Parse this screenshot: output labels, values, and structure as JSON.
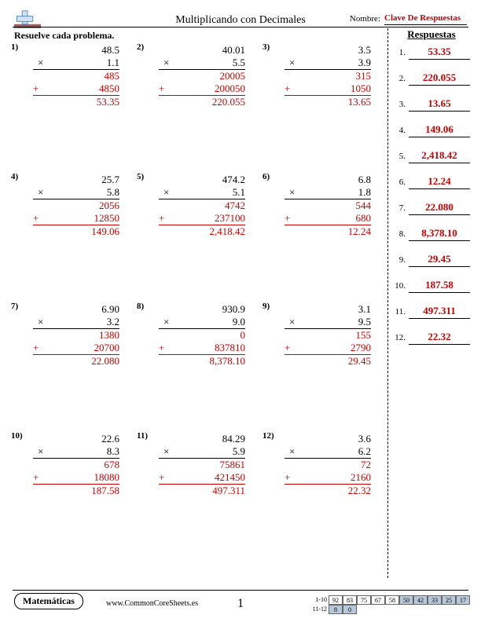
{
  "header": {
    "title": "Multiplicando con Decimales",
    "name_label": "Nombre:",
    "name_value": "Clave De Respuestas"
  },
  "solve_label": "Resuelve cada problema.",
  "problems": [
    {
      "n": "1)",
      "top": "48.5",
      "bot": "1.1",
      "p1": "485",
      "p2": "4850",
      "res": "53.35"
    },
    {
      "n": "2)",
      "top": "40.01",
      "bot": "5.5",
      "p1": "20005",
      "p2": "200050",
      "res": "220.055"
    },
    {
      "n": "3)",
      "top": "3.5",
      "bot": "3.9",
      "p1": "315",
      "p2": "1050",
      "res": "13.65"
    },
    {
      "n": "4)",
      "top": "25.7",
      "bot": "5.8",
      "p1": "2056",
      "p2": "12850",
      "res": "149.06"
    },
    {
      "n": "5)",
      "top": "474.2",
      "bot": "5.1",
      "p1": "4742",
      "p2": "237100",
      "res": "2,418.42"
    },
    {
      "n": "6)",
      "top": "6.8",
      "bot": "1.8",
      "p1": "544",
      "p2": "680",
      "res": "12.24"
    },
    {
      "n": "7)",
      "top": "6.90",
      "bot": "3.2",
      "p1": "1380",
      "p2": "20700",
      "res": "22.080"
    },
    {
      "n": "8)",
      "top": "930.9",
      "bot": "9.0",
      "p1": "0",
      "p2": "837810",
      "res": "8,378.10"
    },
    {
      "n": "9)",
      "top": "3.1",
      "bot": "9.5",
      "p1": "155",
      "p2": "2790",
      "res": "29.45"
    },
    {
      "n": "10)",
      "top": "22.6",
      "bot": "8.3",
      "p1": "678",
      "p2": "18080",
      "res": "187.58"
    },
    {
      "n": "11)",
      "top": "84.29",
      "bot": "5.9",
      "p1": "75861",
      "p2": "421450",
      "res": "497.311"
    },
    {
      "n": "12)",
      "top": "3.6",
      "bot": "6.2",
      "p1": "72",
      "p2": "2160",
      "res": "22.32"
    }
  ],
  "mult_sign": "×",
  "plus_sign": "+",
  "answers": {
    "title": "Respuestas",
    "items": [
      {
        "n": "1.",
        "v": "53.35"
      },
      {
        "n": "2.",
        "v": "220.055"
      },
      {
        "n": "3.",
        "v": "13.65"
      },
      {
        "n": "4.",
        "v": "149.06"
      },
      {
        "n": "5.",
        "v": "2,418.42"
      },
      {
        "n": "6.",
        "v": "12.24"
      },
      {
        "n": "7.",
        "v": "22.080"
      },
      {
        "n": "8.",
        "v": "8,378.10"
      },
      {
        "n": "9.",
        "v": "29.45"
      },
      {
        "n": "10.",
        "v": "187.58"
      },
      {
        "n": "11.",
        "v": "497.311"
      },
      {
        "n": "12.",
        "v": "22.32"
      }
    ]
  },
  "footer": {
    "subject": "Matemáticas",
    "url": "www.CommonCoreSheets.es",
    "page": "1",
    "scores": {
      "range1": "1-10",
      "range2": "11-12",
      "row1": [
        "92",
        "83",
        "75",
        "67",
        "58",
        "50",
        "42",
        "33",
        "25",
        "17"
      ],
      "row2": [
        "8",
        "0"
      ]
    }
  }
}
